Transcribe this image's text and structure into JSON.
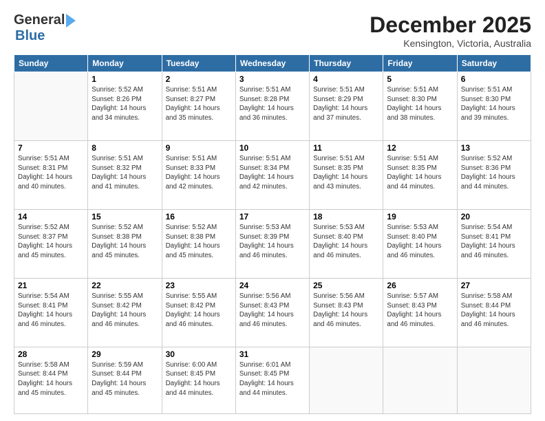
{
  "header": {
    "logo_line1": "General",
    "logo_line2": "Blue",
    "month": "December 2025",
    "location": "Kensington, Victoria, Australia"
  },
  "days_of_week": [
    "Sunday",
    "Monday",
    "Tuesday",
    "Wednesday",
    "Thursday",
    "Friday",
    "Saturday"
  ],
  "weeks": [
    [
      {
        "day": "",
        "info": ""
      },
      {
        "day": "1",
        "info": "Sunrise: 5:52 AM\nSunset: 8:26 PM\nDaylight: 14 hours\nand 34 minutes."
      },
      {
        "day": "2",
        "info": "Sunrise: 5:51 AM\nSunset: 8:27 PM\nDaylight: 14 hours\nand 35 minutes."
      },
      {
        "day": "3",
        "info": "Sunrise: 5:51 AM\nSunset: 8:28 PM\nDaylight: 14 hours\nand 36 minutes."
      },
      {
        "day": "4",
        "info": "Sunrise: 5:51 AM\nSunset: 8:29 PM\nDaylight: 14 hours\nand 37 minutes."
      },
      {
        "day": "5",
        "info": "Sunrise: 5:51 AM\nSunset: 8:30 PM\nDaylight: 14 hours\nand 38 minutes."
      },
      {
        "day": "6",
        "info": "Sunrise: 5:51 AM\nSunset: 8:30 PM\nDaylight: 14 hours\nand 39 minutes."
      }
    ],
    [
      {
        "day": "7",
        "info": "Sunrise: 5:51 AM\nSunset: 8:31 PM\nDaylight: 14 hours\nand 40 minutes."
      },
      {
        "day": "8",
        "info": "Sunrise: 5:51 AM\nSunset: 8:32 PM\nDaylight: 14 hours\nand 41 minutes."
      },
      {
        "day": "9",
        "info": "Sunrise: 5:51 AM\nSunset: 8:33 PM\nDaylight: 14 hours\nand 42 minutes."
      },
      {
        "day": "10",
        "info": "Sunrise: 5:51 AM\nSunset: 8:34 PM\nDaylight: 14 hours\nand 42 minutes."
      },
      {
        "day": "11",
        "info": "Sunrise: 5:51 AM\nSunset: 8:35 PM\nDaylight: 14 hours\nand 43 minutes."
      },
      {
        "day": "12",
        "info": "Sunrise: 5:51 AM\nSunset: 8:35 PM\nDaylight: 14 hours\nand 44 minutes."
      },
      {
        "day": "13",
        "info": "Sunrise: 5:52 AM\nSunset: 8:36 PM\nDaylight: 14 hours\nand 44 minutes."
      }
    ],
    [
      {
        "day": "14",
        "info": "Sunrise: 5:52 AM\nSunset: 8:37 PM\nDaylight: 14 hours\nand 45 minutes."
      },
      {
        "day": "15",
        "info": "Sunrise: 5:52 AM\nSunset: 8:38 PM\nDaylight: 14 hours\nand 45 minutes."
      },
      {
        "day": "16",
        "info": "Sunrise: 5:52 AM\nSunset: 8:38 PM\nDaylight: 14 hours\nand 45 minutes."
      },
      {
        "day": "17",
        "info": "Sunrise: 5:53 AM\nSunset: 8:39 PM\nDaylight: 14 hours\nand 46 minutes."
      },
      {
        "day": "18",
        "info": "Sunrise: 5:53 AM\nSunset: 8:40 PM\nDaylight: 14 hours\nand 46 minutes."
      },
      {
        "day": "19",
        "info": "Sunrise: 5:53 AM\nSunset: 8:40 PM\nDaylight: 14 hours\nand 46 minutes."
      },
      {
        "day": "20",
        "info": "Sunrise: 5:54 AM\nSunset: 8:41 PM\nDaylight: 14 hours\nand 46 minutes."
      }
    ],
    [
      {
        "day": "21",
        "info": "Sunrise: 5:54 AM\nSunset: 8:41 PM\nDaylight: 14 hours\nand 46 minutes."
      },
      {
        "day": "22",
        "info": "Sunrise: 5:55 AM\nSunset: 8:42 PM\nDaylight: 14 hours\nand 46 minutes."
      },
      {
        "day": "23",
        "info": "Sunrise: 5:55 AM\nSunset: 8:42 PM\nDaylight: 14 hours\nand 46 minutes."
      },
      {
        "day": "24",
        "info": "Sunrise: 5:56 AM\nSunset: 8:43 PM\nDaylight: 14 hours\nand 46 minutes."
      },
      {
        "day": "25",
        "info": "Sunrise: 5:56 AM\nSunset: 8:43 PM\nDaylight: 14 hours\nand 46 minutes."
      },
      {
        "day": "26",
        "info": "Sunrise: 5:57 AM\nSunset: 8:43 PM\nDaylight: 14 hours\nand 46 minutes."
      },
      {
        "day": "27",
        "info": "Sunrise: 5:58 AM\nSunset: 8:44 PM\nDaylight: 14 hours\nand 46 minutes."
      }
    ],
    [
      {
        "day": "28",
        "info": "Sunrise: 5:58 AM\nSunset: 8:44 PM\nDaylight: 14 hours\nand 45 minutes."
      },
      {
        "day": "29",
        "info": "Sunrise: 5:59 AM\nSunset: 8:44 PM\nDaylight: 14 hours\nand 45 minutes."
      },
      {
        "day": "30",
        "info": "Sunrise: 6:00 AM\nSunset: 8:45 PM\nDaylight: 14 hours\nand 44 minutes."
      },
      {
        "day": "31",
        "info": "Sunrise: 6:01 AM\nSunset: 8:45 PM\nDaylight: 14 hours\nand 44 minutes."
      },
      {
        "day": "",
        "info": ""
      },
      {
        "day": "",
        "info": ""
      },
      {
        "day": "",
        "info": ""
      }
    ]
  ]
}
